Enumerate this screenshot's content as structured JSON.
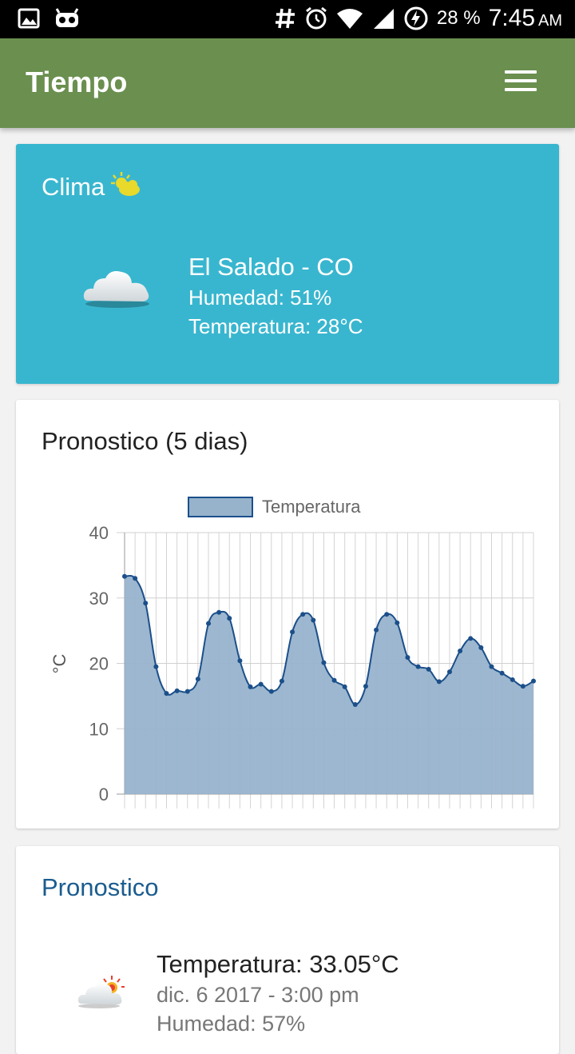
{
  "status_bar": {
    "battery": "28 %",
    "time": "7:45",
    "ampm": "AM"
  },
  "app_bar": {
    "title": "Tiempo"
  },
  "weather_card": {
    "title": "Clima",
    "location": "El Salado - CO",
    "humidity": "Humedad: 51%",
    "temperature": "Temperatura: 28°C"
  },
  "forecast_chart": {
    "title": "Pronostico (5 dias)"
  },
  "chart_data": {
    "type": "area",
    "legend": [
      "Temperatura"
    ],
    "ylabel": "°C",
    "ylim": [
      0,
      40
    ],
    "yticks": [
      0,
      10,
      20,
      30,
      40
    ],
    "grid": true,
    "legend_position": "top",
    "fill_color": "#97b3cc",
    "line_color": "#1b4f8a",
    "series": [
      {
        "name": "Temperatura",
        "values": [
          33.3,
          33.0,
          29.2,
          19.5,
          15.4,
          15.8,
          15.7,
          17.6,
          26.1,
          27.8,
          26.9,
          20.4,
          16.4,
          16.8,
          15.7,
          17.3,
          24.8,
          27.5,
          26.6,
          20.1,
          17.4,
          16.4,
          13.7,
          16.5,
          25.1,
          27.5,
          26.2,
          20.9,
          19.5,
          19.1,
          17.2,
          18.7,
          21.9,
          23.8,
          22.4,
          19.5,
          18.5,
          17.5,
          16.5,
          17.3
        ]
      }
    ]
  },
  "forecast_list": {
    "title": "Pronostico",
    "items": [
      {
        "temperature": "Temperatura: 33.05°C",
        "date": "dic. 6 2017 - 3:00 pm",
        "humidity": "Humedad: 57%"
      }
    ]
  },
  "colors": {
    "app_bar": "#6a8f4f",
    "weather_card": "#39b6cf",
    "accent_title": "#1b5c8f"
  }
}
